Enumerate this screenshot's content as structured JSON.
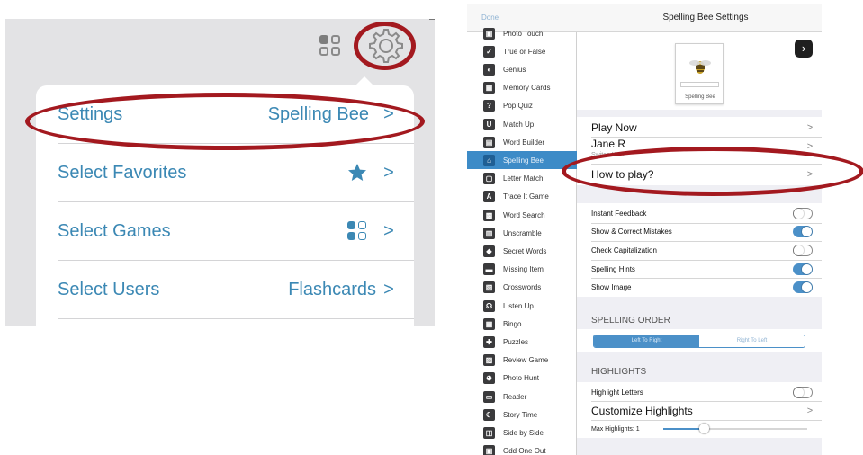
{
  "left_panel": {
    "popover": {
      "rows": [
        {
          "label": "Settings",
          "value": "Spelling Bee",
          "chevron": ">"
        },
        {
          "label": "Select Favorites",
          "icon": "star-icon",
          "chevron": ">"
        },
        {
          "label": "Select Games",
          "icon": "grid-icon",
          "chevron": ">"
        },
        {
          "label": "Select Users",
          "value": "Flashcards",
          "chevron": ">"
        }
      ]
    },
    "toolbar": {
      "grid_icon": "grid-icon",
      "gear_icon": "gear-icon"
    }
  },
  "right_panel": {
    "navbar": {
      "done_label": "Done",
      "title": "Spelling Bee Settings"
    },
    "sidebar": {
      "items": [
        {
          "label": "Photo Touch",
          "icon": "photo-icon",
          "selected": false
        },
        {
          "label": "True or False",
          "icon": "check-icon",
          "selected": false
        },
        {
          "label": "Genius",
          "icon": "genius-icon",
          "selected": false
        },
        {
          "label": "Memory Cards",
          "icon": "memory-icon",
          "selected": false
        },
        {
          "label": "Pop Quiz",
          "icon": "quiz-icon",
          "selected": false
        },
        {
          "label": "Match Up",
          "icon": "match-icon",
          "selected": false
        },
        {
          "label": "Word Builder",
          "icon": "builder-icon",
          "selected": false
        },
        {
          "label": "Spelling Bee",
          "icon": "bee-icon",
          "selected": true
        },
        {
          "label": "Letter Match",
          "icon": "letter-icon",
          "selected": false
        },
        {
          "label": "Trace It Game",
          "icon": "trace-icon",
          "selected": false
        },
        {
          "label": "Word Search",
          "icon": "search-icon",
          "selected": false
        },
        {
          "label": "Unscramble",
          "icon": "unscramble-icon",
          "selected": false
        },
        {
          "label": "Secret Words",
          "icon": "secret-icon",
          "selected": false
        },
        {
          "label": "Missing Item",
          "icon": "missing-icon",
          "selected": false
        },
        {
          "label": "Crosswords",
          "icon": "crossword-icon",
          "selected": false
        },
        {
          "label": "Listen Up",
          "icon": "listen-icon",
          "selected": false
        },
        {
          "label": "Bingo",
          "icon": "bingo-icon",
          "selected": false
        },
        {
          "label": "Puzzles",
          "icon": "puzzle-icon",
          "selected": false
        },
        {
          "label": "Review Game",
          "icon": "review-icon",
          "selected": false
        },
        {
          "label": "Photo Hunt",
          "icon": "hunt-icon",
          "selected": false
        },
        {
          "label": "Reader",
          "icon": "reader-icon",
          "selected": false
        },
        {
          "label": "Story Time",
          "icon": "story-icon",
          "selected": false
        },
        {
          "label": "Side by Side",
          "icon": "side-icon",
          "selected": false
        },
        {
          "label": "Odd One Out",
          "icon": "odd-icon",
          "selected": false
        }
      ]
    },
    "game_card": {
      "caption": "Spelling Bee"
    },
    "actions": {
      "play_now": "Play Now",
      "user_name": "Jane R",
      "user_sub": "Switch User",
      "how_to_play": "How to play?"
    },
    "toggles": [
      {
        "label": "Instant Feedback",
        "on": false
      },
      {
        "label": "Show & Correct Mistakes",
        "on": true
      },
      {
        "label": "Check Capitalization",
        "on": false
      },
      {
        "label": "Spelling Hints",
        "on": true
      },
      {
        "label": "Show Image",
        "on": true
      }
    ],
    "spelling_order": {
      "header": "SPELLING ORDER",
      "options": [
        "Left To Right",
        "Right To Left"
      ],
      "selected": "Left To Right"
    },
    "highlights": {
      "header": "HIGHLIGHTS",
      "highlight_letters_label": "Highlight Letters",
      "highlight_letters_on": false,
      "customize_label": "Customize Highlights",
      "max_label": "Max Highlights: 1",
      "max_fraction": 0.28
    },
    "colors": {
      "accent": "#4b90c8",
      "selected_row": "#3d8bc7",
      "annotation_ring": "#a3191f"
    }
  }
}
